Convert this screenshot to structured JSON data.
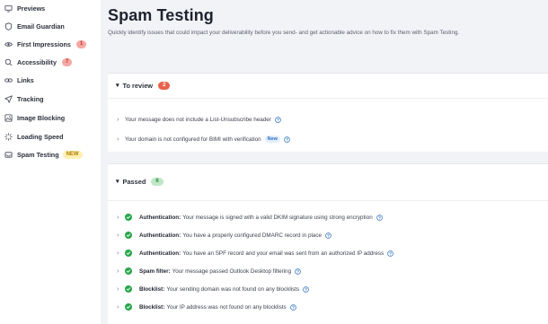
{
  "sidebar": {
    "items": [
      {
        "label": "Previews",
        "icon": "monitor-icon"
      },
      {
        "label": "Email Guardian",
        "icon": "shield-icon"
      },
      {
        "label": "First Impressions",
        "icon": "eye-icon",
        "badge": "1"
      },
      {
        "label": "Accessibility",
        "icon": "magnifier-icon",
        "badge": "7"
      },
      {
        "label": "Links",
        "icon": "link-icon"
      },
      {
        "label": "Tracking",
        "icon": "send-icon"
      },
      {
        "label": "Image Blocking",
        "icon": "image-icon"
      },
      {
        "label": "Loading Speed",
        "icon": "spinner-icon"
      },
      {
        "label": "Spam Testing",
        "icon": "inbox-icon",
        "badge": "NEW"
      }
    ]
  },
  "main": {
    "title": "Spam Testing",
    "subtitle": "Quickly identify issues that could impact your deliverability before you send- and get actionable advice on how to fix them with Spam Testing."
  },
  "review": {
    "title": "To review",
    "count": "2",
    "items": [
      {
        "text": "Your message does not include a List-Unsubscribe header"
      },
      {
        "text": "Your domain is not configured for BIMI with verification",
        "badge": "New"
      }
    ]
  },
  "passed": {
    "title": "Passed",
    "count": "6",
    "items": [
      {
        "label": "Authentication:",
        "text": "Your message is signed with a valid DKIM signature using strong encryption"
      },
      {
        "label": "Authentication:",
        "text": "You have a properly configured DMARC record in place"
      },
      {
        "label": "Authentication:",
        "text": "You have an SPF record and your email was sent from an authorized IP address"
      },
      {
        "label": "Spam filter:",
        "text": "Your message passed Outlook Desktop filtering"
      },
      {
        "label": "Blocklist:",
        "text": "Your sending domain was not found on any blocklists"
      },
      {
        "label": "Blocklist:",
        "text": "Your IP address was not found on any blocklists"
      }
    ]
  },
  "colors": {
    "accent_red": "#e8614d",
    "accent_green": "#27a64a",
    "help_blue": "#2a6fbf",
    "new_yellow": "#fff0b3"
  }
}
